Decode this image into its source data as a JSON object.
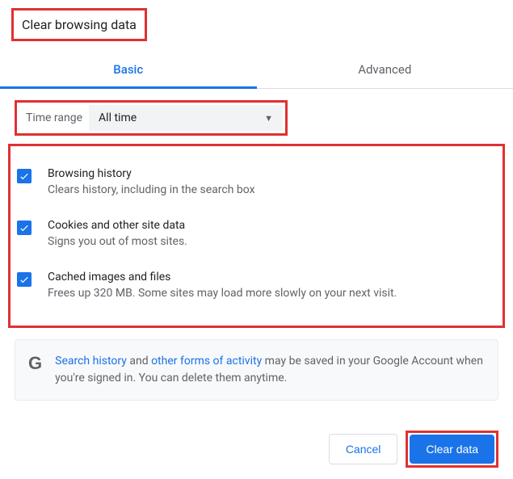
{
  "title": "Clear browsing data",
  "tabs": {
    "basic": "Basic",
    "advanced": "Advanced"
  },
  "timeRange": {
    "label": "Time range",
    "selected": "All time"
  },
  "options": [
    {
      "title": "Browsing history",
      "desc": "Clears history, including in the search box",
      "checked": true
    },
    {
      "title": "Cookies and other site data",
      "desc": "Signs you out of most sites.",
      "checked": true
    },
    {
      "title": "Cached images and files",
      "desc": "Frees up 320 MB. Some sites may load more slowly on your next visit.",
      "checked": true
    }
  ],
  "info": {
    "link1": "Search history",
    "mid1": " and ",
    "link2": "other forms of activity",
    "rest": " may be saved in your Google Account when you're signed in. You can delete them anytime."
  },
  "buttons": {
    "cancel": "Cancel",
    "clear": "Clear data"
  },
  "highlights": {
    "color": "#e03131"
  }
}
